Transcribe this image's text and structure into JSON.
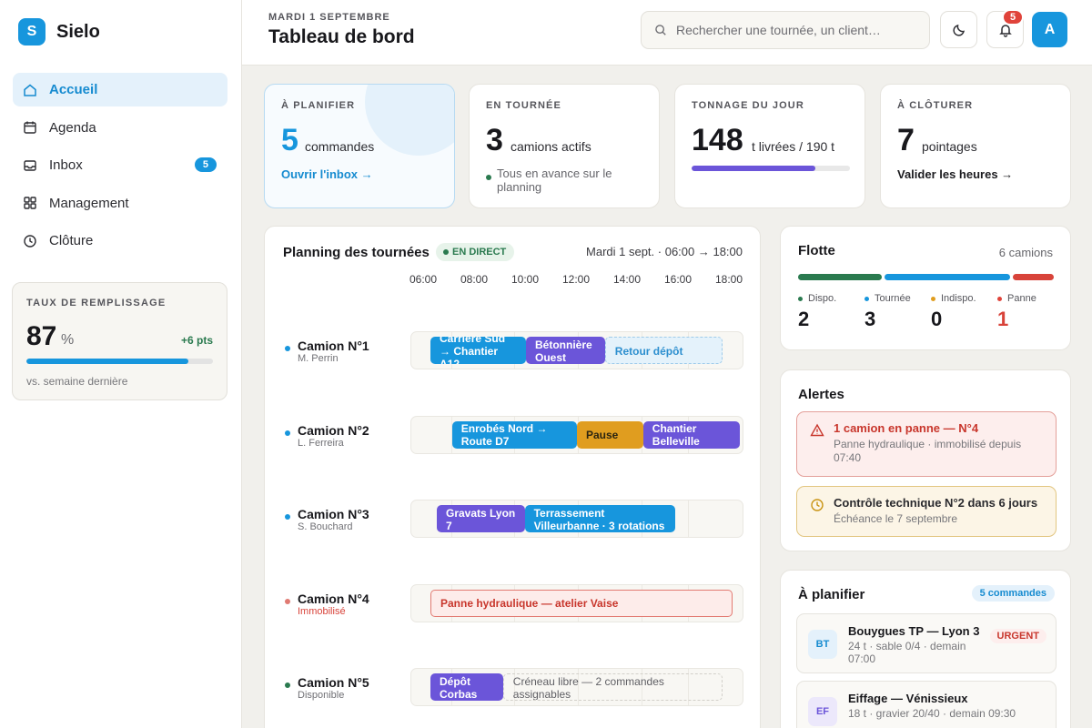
{
  "brand": {
    "logo_letter": "S",
    "name": "Sielo"
  },
  "nav": [
    {
      "label": "Accueil",
      "icon": "home-icon",
      "active": true
    },
    {
      "label": "Agenda",
      "icon": "calendar-icon"
    },
    {
      "label": "Inbox",
      "icon": "inbox-icon",
      "badge": "5"
    },
    {
      "label": "Management",
      "icon": "grid-icon"
    },
    {
      "label": "Clôture",
      "icon": "clock-icon"
    }
  ],
  "fill_rate": {
    "title": "TAUX DE REMPLISSAGE",
    "value": "87",
    "unit": "%",
    "delta": "+6 pts",
    "progress": 0.87,
    "note": "vs. semaine dernière"
  },
  "header": {
    "date": "MARDI 1 SEPTEMBRE",
    "title": "Tableau de bord",
    "search_placeholder": "Rechercher une tournée, un client…",
    "notif_count": "5",
    "avatar": "A"
  },
  "kpis": {
    "to_plan": {
      "title": "À PLANIFIER",
      "value": "5",
      "unit": "commandes",
      "link": "Ouvrir l'inbox →"
    },
    "on_tour": {
      "title": "EN TOURNÉE",
      "value": "3",
      "unit": "camions actifs",
      "note": "Tous en avance sur le planning"
    },
    "tonnage": {
      "title": "TONNAGE DU JOUR",
      "value": "148",
      "unit": "t livrées / 190 t",
      "progress": 0.78
    },
    "to_close": {
      "title": "À CLÔTURER",
      "value": "7",
      "unit": "pointages",
      "link": "Valider les heures →"
    }
  },
  "planning": {
    "title": "Planning des tournées",
    "live": "EN DIRECT",
    "range": "Mardi 1 sept. · 06:00 → 18:00",
    "hours": [
      "06:00",
      "08:00",
      "10:00",
      "12:00",
      "14:00",
      "16:00",
      "18:00"
    ],
    "trucks": [
      {
        "name": "Camion N°1",
        "sub": "M. Perrin",
        "status": "active",
        "segments": [
          {
            "label": "Carrière Sud → Chantier A12",
            "start": 6.25,
            "end": 10.0,
            "style": "blue"
          },
          {
            "label": "Bétonnière Ouest",
            "start": 10.0,
            "end": 13.1,
            "style": "purple"
          },
          {
            "label": "Retour dépôt",
            "start": 13.1,
            "end": 17.7,
            "style": "light"
          }
        ]
      },
      {
        "name": "Camion N°2",
        "sub": "L. Ferreira",
        "status": "active",
        "segments": [
          {
            "label": "Enrobés Nord → Route D7",
            "start": 7.1,
            "end": 12.0,
            "style": "blue"
          },
          {
            "label": "Pause",
            "start": 12.0,
            "end": 14.6,
            "style": "orange"
          },
          {
            "label": "Chantier Belleville",
            "start": 14.6,
            "end": 18.4,
            "style": "purple"
          }
        ]
      },
      {
        "name": "Camion N°3",
        "sub": "S. Bouchard",
        "status": "active",
        "segments": [
          {
            "label": "Gravats Lyon 7",
            "start": 6.5,
            "end": 9.95,
            "style": "purple"
          },
          {
            "label": "Terrassement Villeurbanne · 3 rotations",
            "start": 9.95,
            "end": 15.85,
            "style": "blue"
          }
        ]
      },
      {
        "name": "Camion N°4",
        "sub": "Immobilisé",
        "status": "down",
        "segments": [
          {
            "label": "Panne hydraulique — atelier Vaise",
            "start": 6.25,
            "end": 18.1,
            "style": "red"
          }
        ]
      },
      {
        "name": "Camion N°5",
        "sub": "Disponible",
        "status": "available",
        "segments": [
          {
            "label": "Dépôt Corbas",
            "start": 6.25,
            "end": 9.1,
            "style": "purple"
          },
          {
            "label": "Créneau libre — 2 commandes assignables",
            "start": 9.1,
            "end": 17.7,
            "style": "free"
          }
        ]
      }
    ]
  },
  "fleet": {
    "title": "Flotte",
    "count": "6 camions",
    "stats": [
      {
        "label": "Dispo.",
        "value": "2",
        "color": "#2a7a4f"
      },
      {
        "label": "Tournée",
        "value": "3",
        "color": "#1796dd"
      },
      {
        "label": "Indispo.",
        "value": "0",
        "color": "#e09d1f"
      },
      {
        "label": "Panne",
        "value": "1",
        "color": "#e0433a"
      }
    ]
  },
  "alerts": {
    "title": "Alertes",
    "items": [
      {
        "title": "1 camion en panne — N°4",
        "sub": "Panne hydraulique · immobilisé depuis 07:40",
        "level": "danger"
      },
      {
        "title": "Contrôle technique N°2 dans 6 jours",
        "sub": "Échéance le 7 septembre",
        "level": "warning"
      }
    ]
  },
  "to_plan": {
    "title": "À planifier",
    "count": "5 commandes",
    "items": [
      {
        "initials": "BT",
        "name": "Bouygues TP — Lyon 3",
        "sub": "24 t · sable 0/4 · demain 07:00",
        "tag": "URGENT"
      },
      {
        "initials": "EF",
        "name": "Eiffage — Vénissieux",
        "sub": "18 t · gravier 20/40 · demain 09:30"
      }
    ]
  },
  "colors": {
    "accent": "#1796dd",
    "purple": "#6b55d9",
    "orange": "#e09d1f",
    "danger": "#e0433a",
    "success": "#2a7a4f"
  }
}
